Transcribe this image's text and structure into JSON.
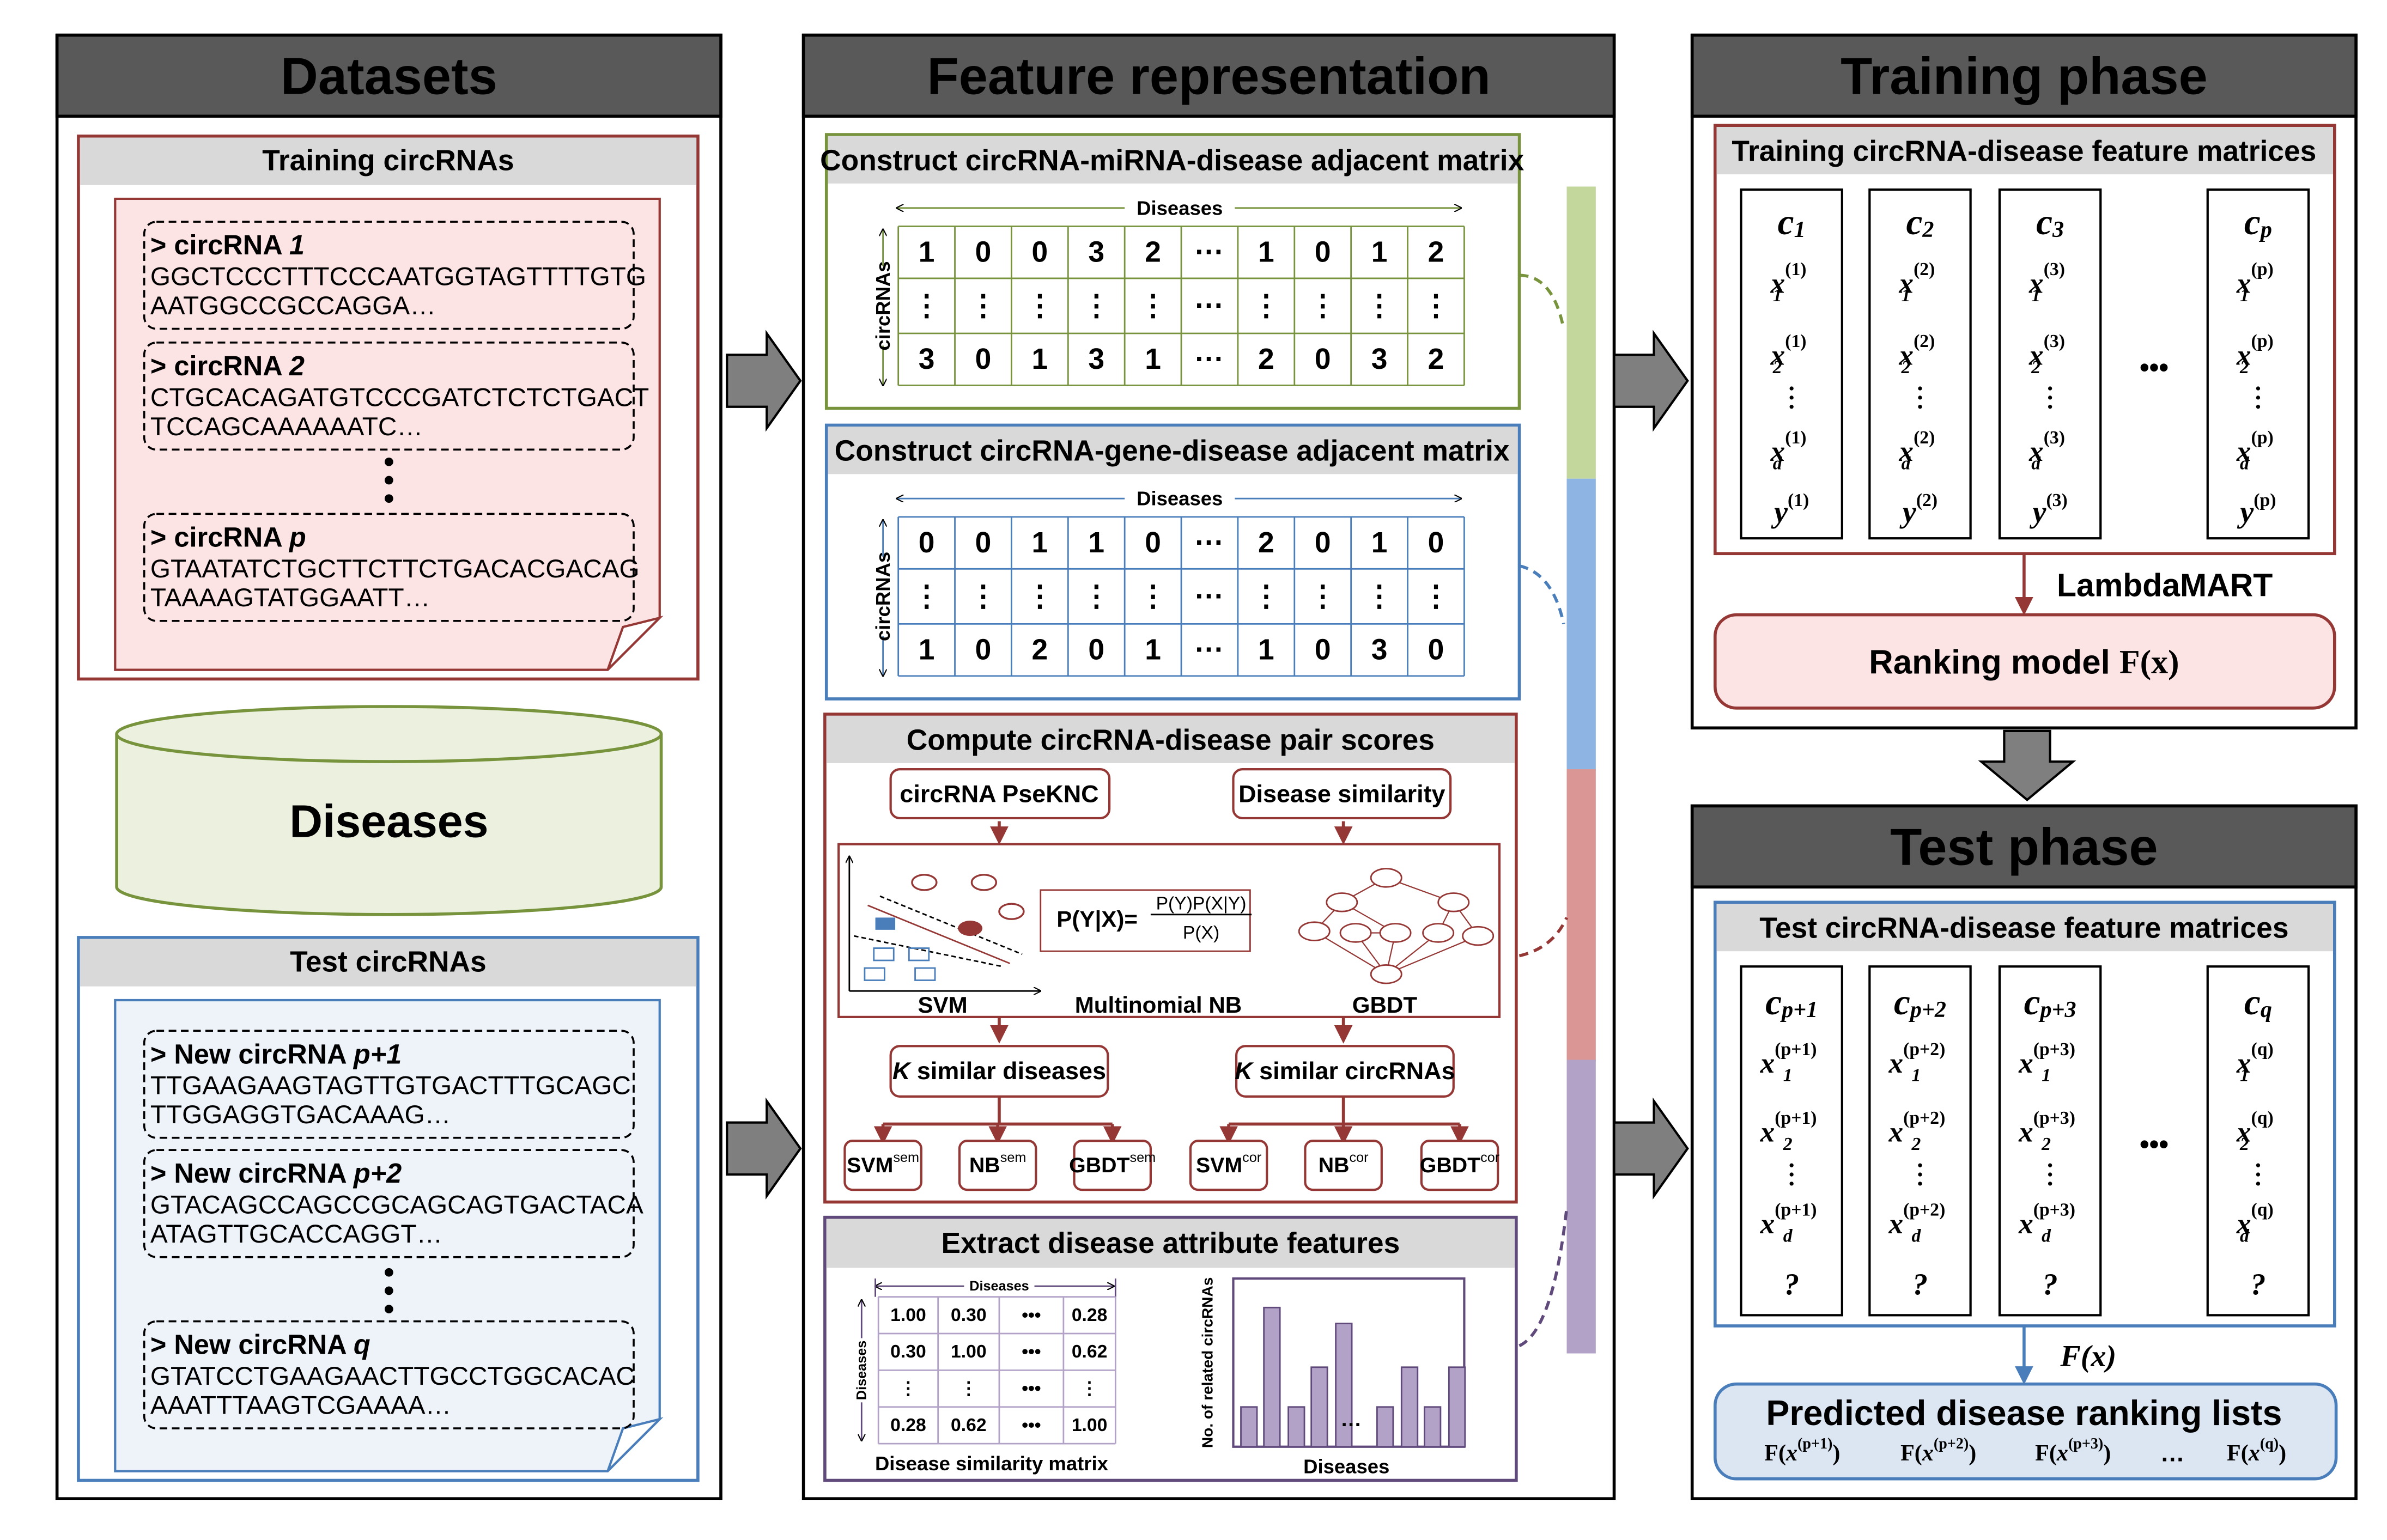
{
  "colors": {
    "panel_header": "#595959",
    "sub_header": "#d9d9d9",
    "red": "#953735",
    "green": "#77933c",
    "blue": "#4a7ebb",
    "purple": "#604a7b",
    "pink_fill": "#fde4e4",
    "green_fill": "#ebf1de",
    "blue_fill": "#eef3fa",
    "pink_box": "#fce4e4",
    "blue_box": "#dce6f2",
    "bar_green": "#c3d69b",
    "bar_blue": "#8eb4e3",
    "bar_red": "#d99694",
    "bar_purple": "#b3a2c7"
  },
  "datasets": {
    "title": "Datasets",
    "training": {
      "title": "Training circRNAs",
      "seqs": [
        {
          "prefix": "> circRNA ",
          "var": "1",
          "line1": "GGCTCCCTTTCCCAATGGTAGTTTTGTG",
          "line2": "AATGGCCGCCAGGA…"
        },
        {
          "prefix": "> circRNA ",
          "var": "2",
          "line1": "CTGCACAGATGTCCCGATCTCTCTGACT",
          "line2": "TCCAGCAAAAAATC…"
        },
        {
          "prefix": "> circRNA ",
          "var": "p",
          "line1": "GTAATATCTGCTTCTTCTGACACGACAG",
          "line2": "TAAAAGTATGGAATT…"
        }
      ]
    },
    "diseases": "Diseases",
    "test": {
      "title": "Test circRNAs",
      "seqs": [
        {
          "prefix": "> New circRNA ",
          "var": "p+1",
          "line1": "TTGAAGAAGTAGTTGTGACTTTGCAGC",
          "line2": "TTGGAGGTGACAAAG…"
        },
        {
          "prefix": "> New circRNA ",
          "var": "p+2",
          "line1": "GTACAGCCAGCCGCAGCAGTGACTACA",
          "line2": "ATAGTTGCACCAGGT…"
        },
        {
          "prefix": "> New circRNA ",
          "var": "q",
          "line1": "GTATCCTGAAGAACTTGCCTGGCACAC",
          "line2": "AAATTTAAGTCGAAAA…"
        }
      ]
    }
  },
  "feature": {
    "title": "Feature representation",
    "mirna": {
      "title": "Construct circRNA-miRNA-disease adjacent matrix",
      "col_label": "Diseases",
      "row_label": "circRNAs",
      "rows": [
        [
          "1",
          "0",
          "0",
          "3",
          "2",
          "···",
          "1",
          "0",
          "1",
          "2"
        ],
        [
          "⋮",
          "⋮",
          "⋮",
          "⋮",
          "⋮",
          "···",
          "⋮",
          "⋮",
          "⋮",
          "⋮"
        ],
        [
          "3",
          "0",
          "1",
          "3",
          "1",
          "···",
          "2",
          "0",
          "3",
          "2"
        ]
      ]
    },
    "gene": {
      "title": "Construct circRNA-gene-disease adjacent matrix",
      "col_label": "Diseases",
      "row_label": "circRNAs",
      "rows": [
        [
          "0",
          "0",
          "1",
          "1",
          "0",
          "···",
          "2",
          "0",
          "1",
          "0"
        ],
        [
          "⋮",
          "⋮",
          "⋮",
          "⋮",
          "⋮",
          "···",
          "⋮",
          "⋮",
          "⋮",
          "⋮"
        ],
        [
          "1",
          "0",
          "2",
          "0",
          "1",
          "···",
          "1",
          "0",
          "3",
          "0"
        ]
      ]
    },
    "scores": {
      "title": "Compute circRNA-disease pair scores",
      "pseknc": "circRNA PseKNC",
      "dis_sim": "Disease similarity",
      "formula_lhs": "P(Y|X)=",
      "formula_num": "P(Y)P(X|Y)",
      "formula_den": "P(X)",
      "svm": "SVM",
      "nb": "Multinomial NB",
      "gbdt": "GBDT",
      "k_dis_var": "K",
      "k_dis": " similar diseases",
      "k_circ_var": "K",
      "k_circ": " similar circRNAs",
      "models": [
        {
          "base": "SVM",
          "sup": "sem"
        },
        {
          "base": "NB",
          "sup": "sem"
        },
        {
          "base": "GBDT",
          "sup": "sem"
        },
        {
          "base": "SVM",
          "sup": "cor"
        },
        {
          "base": "NB",
          "sup": "cor"
        },
        {
          "base": "GBDT",
          "sup": "cor"
        }
      ]
    },
    "attr": {
      "title": "Extract disease attribute features",
      "col_label": "Diseases",
      "row_label": "Diseases",
      "caption": "Disease similarity matrix",
      "matrix": [
        [
          "1.00",
          "0.30",
          "•••",
          "0.28"
        ],
        [
          "0.30",
          "1.00",
          "•••",
          "0.62"
        ],
        [
          "⋮",
          "⋮",
          "•••",
          "⋮"
        ],
        [
          "0.28",
          "0.62",
          "•••",
          "1.00"
        ]
      ],
      "chart": {
        "ylabel": "No. of related circRNAs",
        "xlabel": "Diseases",
        "ellipsis": "…",
        "bars": [
          1,
          3.5,
          1,
          2,
          3.1,
          1,
          2,
          1,
          2
        ]
      }
    }
  },
  "training": {
    "title": "Training phase",
    "matrix_title": "Training circRNA-disease feature matrices",
    "ellipsis": "•••",
    "columns": [
      {
        "c": "1",
        "s": "(1)",
        "last": "y",
        "last_sup": "(1)"
      },
      {
        "c": "2",
        "s": "(2)",
        "last": "y",
        "last_sup": "(2)"
      },
      {
        "c": "3",
        "s": "(3)",
        "last": "y",
        "last_sup": "(3)"
      },
      {
        "c": "p",
        "s": "(p)",
        "last": "y",
        "last_sup": "(p)"
      }
    ],
    "algo": "LambdaMART",
    "model_label": "Ranking model ",
    "model_fx": "F(x)"
  },
  "test": {
    "title": "Test phase",
    "matrix_title": "Test circRNA-disease feature matrices",
    "ellipsis": "•••",
    "columns": [
      {
        "c": "p+1",
        "s": "(p+1)",
        "last": "?",
        "last_sup": ""
      },
      {
        "c": "p+2",
        "s": "(p+2)",
        "last": "?",
        "last_sup": ""
      },
      {
        "c": "p+3",
        "s": "(p+3)",
        "last": "?",
        "last_sup": ""
      },
      {
        "c": "q",
        "s": "(q)",
        "last": "?",
        "last_sup": ""
      }
    ],
    "fx": "F(x)",
    "result_title": "Predicted disease ranking lists",
    "results": [
      "(p+1)",
      "(p+2)",
      "(p+3)",
      "…",
      "(q)"
    ]
  }
}
